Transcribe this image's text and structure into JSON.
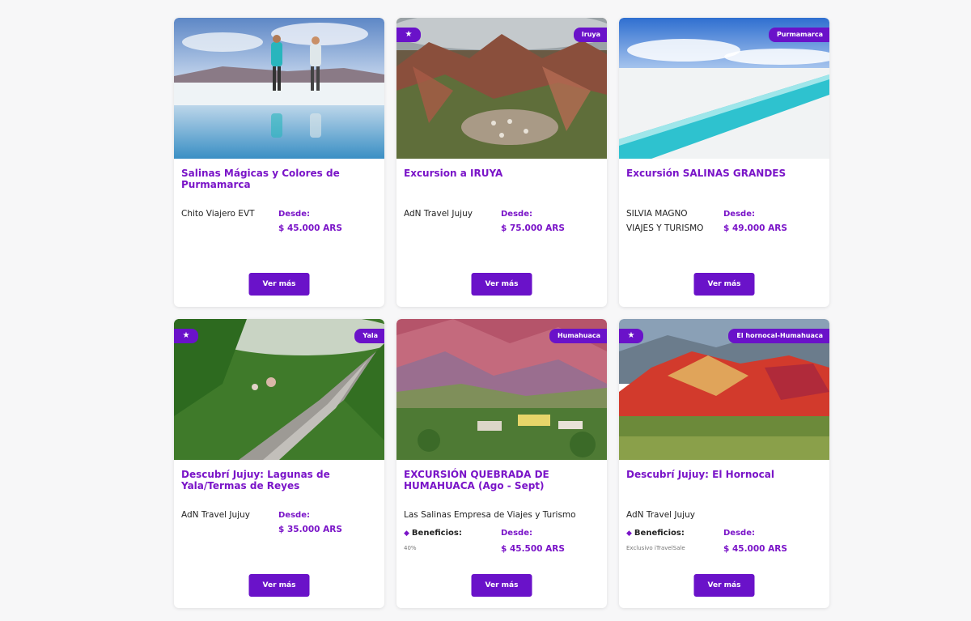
{
  "cards": [
    {
      "title": "Salinas Mágicas y Colores de Purmamarca",
      "agency": "Chito Viajero EVT",
      "desde_label": "Desde:",
      "price": "$ 45.000 ARS",
      "button": "Ver más"
    },
    {
      "badge": "Iruya",
      "title": "Excursion a IRUYA",
      "agency": "AdN Travel Jujuy",
      "desde_label": "Desde:",
      "price": "$ 75.000 ARS",
      "button": "Ver más"
    },
    {
      "badge": "Purmamarca",
      "title": "Excursión SALINAS GRANDES",
      "agency_line1": "SILVIA MAGNO",
      "agency_line2": "VIAJES Y TURISMO",
      "desde_label": "Desde:",
      "price": "$ 49.000 ARS",
      "button": "Ver más"
    },
    {
      "badge": "Yala",
      "title": "Descubrí Jujuy: Lagunas de Yala/Termas de Reyes",
      "agency": "AdN Travel Jujuy",
      "desde_label": "Desde:",
      "price": "$ 35.000 ARS",
      "button": "Ver más"
    },
    {
      "badge": "Humahuaca",
      "title": "EXCURSIÓN QUEBRADA DE HUMAHUACA (Ago - Sept)",
      "agency": "Las Salinas Empresa de Viajes y Turismo",
      "benefits_label": "Beneficios:",
      "benefits_value": "40%",
      "desde_label": "Desde:",
      "price": "$ 45.500 ARS",
      "button": "Ver más"
    },
    {
      "badge": "El hornocal-Humahuaca",
      "title": "Descubrí Jujuy: El Hornocal",
      "agency": "AdN Travel Jujuy",
      "benefits_label": "Beneficios:",
      "benefits_value": "Exclusivo iTravelSale",
      "desde_label": "Desde:",
      "price": "$ 45.000 ARS",
      "button": "Ver más"
    }
  ],
  "icons": {
    "star": "star-icon",
    "tag": "tag-icon"
  },
  "colors": {
    "accent": "#6a12c9",
    "title": "#7a14c8"
  }
}
